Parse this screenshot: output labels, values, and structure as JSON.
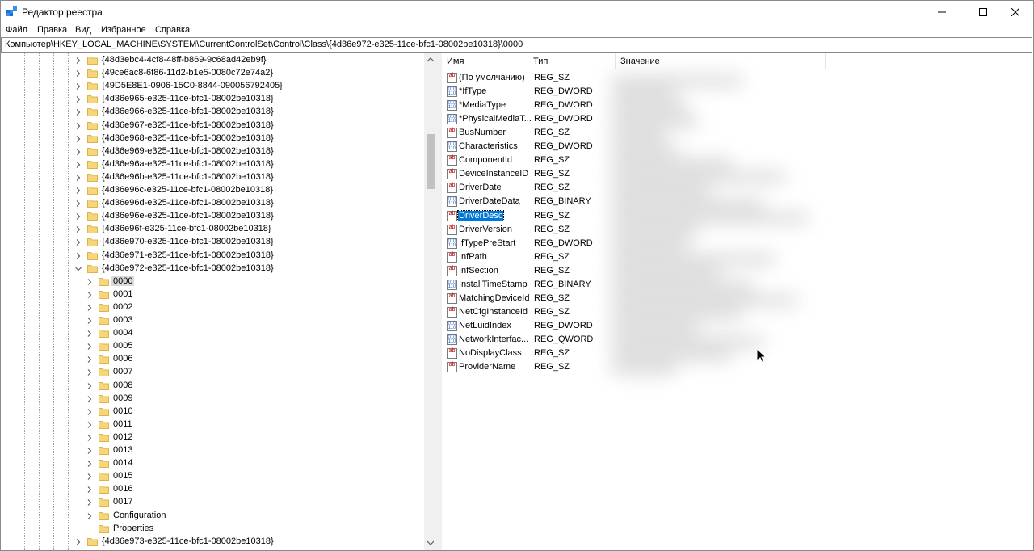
{
  "window": {
    "title": "Редактор реестра",
    "minimize_glyph": "—",
    "maximize_glyph": "☐",
    "close_glyph": "✕"
  },
  "menu": [
    {
      "label": "Файл"
    },
    {
      "label": "Правка"
    },
    {
      "label": "Вид"
    },
    {
      "label": "Избранное"
    },
    {
      "label": "Справка"
    }
  ],
  "address": "Компьютер\\HKEY_LOCAL_MACHINE\\SYSTEM\\CurrentControlSet\\Control\\Class\\{4d36e972-e325-11ce-bfc1-08002be10318}\\0000",
  "tree": {
    "class_keys": [
      "{48d3ebc4-4cf8-48ff-b869-9c68ad42eb9f}",
      "{49ce6ac8-6f86-11d2-b1e5-0080c72e74a2}",
      "{49D5E8E1-0906-15C0-8844-090056792405}",
      "{4d36e965-e325-11ce-bfc1-08002be10318}",
      "{4d36e966-e325-11ce-bfc1-08002be10318}",
      "{4d36e967-e325-11ce-bfc1-08002be10318}",
      "{4d36e968-e325-11ce-bfc1-08002be10318}",
      "{4d36e969-e325-11ce-bfc1-08002be10318}",
      "{4d36e96a-e325-11ce-bfc1-08002be10318}",
      "{4d36e96b-e325-11ce-bfc1-08002be10318}",
      "{4d36e96c-e325-11ce-bfc1-08002be10318}",
      "{4d36e96d-e325-11ce-bfc1-08002be10318}",
      "{4d36e96e-e325-11ce-bfc1-08002be10318}",
      "{4d36e96f-e325-11ce-bfc1-08002be10318}",
      "{4d36e970-e325-11ce-bfc1-08002be10318}",
      "{4d36e971-e325-11ce-bfc1-08002be10318}",
      "{4d36e972-e325-11ce-bfc1-08002be10318}"
    ],
    "subkeys": [
      "0000",
      "0001",
      "0002",
      "0003",
      "0004",
      "0005",
      "0006",
      "0007",
      "0008",
      "0009",
      "0010",
      "0011",
      "0012",
      "0013",
      "0014",
      "0015",
      "0016",
      "0017",
      "Configuration",
      "Properties"
    ],
    "selected_subkey": "0000",
    "last_key": "{4d36e973-e325-11ce-bfc1-08002be10318}"
  },
  "values_pane": {
    "columns": {
      "name": "Имя",
      "type": "Тип",
      "data": "Значение"
    },
    "selected": "DriverDesc",
    "rows": [
      {
        "name": "(По умолчанию)",
        "type": "REG_SZ",
        "icon": "string-value-icon"
      },
      {
        "name": "*IfType",
        "type": "REG_DWORD",
        "icon": "binary-value-icon"
      },
      {
        "name": "*MediaType",
        "type": "REG_DWORD",
        "icon": "binary-value-icon"
      },
      {
        "name": "*PhysicalMediaT...",
        "type": "REG_DWORD",
        "icon": "binary-value-icon"
      },
      {
        "name": "BusNumber",
        "type": "REG_SZ",
        "icon": "string-value-icon"
      },
      {
        "name": "Characteristics",
        "type": "REG_DWORD",
        "icon": "binary-value-icon"
      },
      {
        "name": "ComponentId",
        "type": "REG_SZ",
        "icon": "string-value-icon"
      },
      {
        "name": "DeviceInstanceID",
        "type": "REG_SZ",
        "icon": "string-value-icon"
      },
      {
        "name": "DriverDate",
        "type": "REG_SZ",
        "icon": "string-value-icon"
      },
      {
        "name": "DriverDateData",
        "type": "REG_BINARY",
        "icon": "binary-value-icon"
      },
      {
        "name": "DriverDesc",
        "type": "REG_SZ",
        "icon": "string-value-icon"
      },
      {
        "name": "DriverVersion",
        "type": "REG_SZ",
        "icon": "string-value-icon"
      },
      {
        "name": "IfTypePreStart",
        "type": "REG_DWORD",
        "icon": "binary-value-icon"
      },
      {
        "name": "InfPath",
        "type": "REG_SZ",
        "icon": "string-value-icon"
      },
      {
        "name": "InfSection",
        "type": "REG_SZ",
        "icon": "string-value-icon"
      },
      {
        "name": "InstallTimeStamp",
        "type": "REG_BINARY",
        "icon": "binary-value-icon"
      },
      {
        "name": "MatchingDeviceId",
        "type": "REG_SZ",
        "icon": "string-value-icon"
      },
      {
        "name": "NetCfgInstanceId",
        "type": "REG_SZ",
        "icon": "string-value-icon"
      },
      {
        "name": "NetLuidIndex",
        "type": "REG_DWORD",
        "icon": "binary-value-icon"
      },
      {
        "name": "NetworkInterfac...",
        "type": "REG_QWORD",
        "icon": "binary-value-icon"
      },
      {
        "name": "NoDisplayClass",
        "type": "REG_SZ",
        "icon": "string-value-icon"
      },
      {
        "name": "ProviderName",
        "type": "REG_SZ",
        "icon": "string-value-icon"
      }
    ]
  },
  "colors": {
    "folder": "#f6d57b",
    "folder_edge": "#dcb44a",
    "selection": "#0078d7",
    "tree_selection": "#d9d9d9"
  }
}
